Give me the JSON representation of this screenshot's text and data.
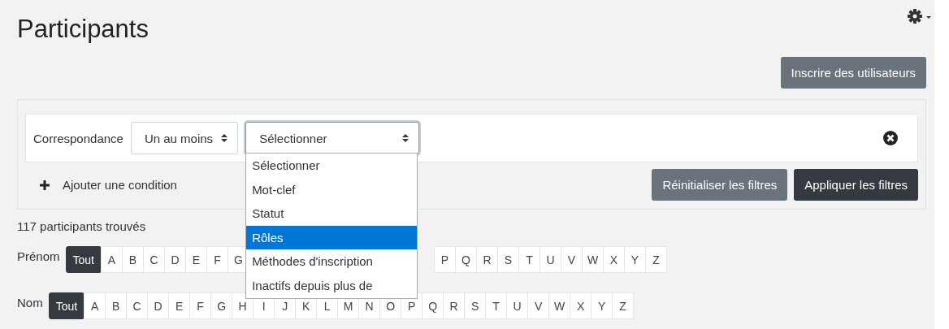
{
  "page": {
    "title": "Participants"
  },
  "enrol_button": "Inscrire des utilisateurs",
  "filter": {
    "match_label": "Correspondance",
    "match_value": "Un au moins",
    "type_value": "Sélectionner",
    "expanded": true,
    "options": [
      {
        "label": "Sélectionner",
        "selected": false
      },
      {
        "label": "Mot-clef",
        "selected": false
      },
      {
        "label": "Statut",
        "selected": false
      },
      {
        "label": "Rôles",
        "selected": true
      },
      {
        "label": "Méthodes d'inscription",
        "selected": false
      },
      {
        "label": "Inactifs depuis plus de",
        "selected": false
      }
    ],
    "add_condition": "Ajouter une condition",
    "reset_button": "Réinitialiser les filtres",
    "apply_button": "Appliquer les filtres"
  },
  "count": "117 participants trouvés",
  "initials_bars": [
    {
      "label": "Prénom",
      "letters": [
        {
          "label": "Tout",
          "selected": true
        },
        {
          "label": "A",
          "selected": false
        },
        {
          "label": "B",
          "selected": false
        },
        {
          "label": "C",
          "selected": false
        },
        {
          "label": "D",
          "selected": false
        },
        {
          "label": "E",
          "selected": false
        },
        {
          "label": "F",
          "selected": false
        },
        {
          "label": "G",
          "selected": false
        }
      ],
      "letters_after_menu": [
        {
          "label": "P",
          "selected": false
        },
        {
          "label": "Q",
          "selected": false
        },
        {
          "label": "R",
          "selected": false
        },
        {
          "label": "S",
          "selected": false
        },
        {
          "label": "T",
          "selected": false
        },
        {
          "label": "U",
          "selected": false
        },
        {
          "label": "V",
          "selected": false
        },
        {
          "label": "W",
          "selected": false
        },
        {
          "label": "X",
          "selected": false
        },
        {
          "label": "Y",
          "selected": false
        },
        {
          "label": "Z",
          "selected": false
        }
      ]
    },
    {
      "label": "Nom",
      "letters": [
        {
          "label": "Tout",
          "selected": true
        },
        {
          "label": "A",
          "selected": false
        },
        {
          "label": "B",
          "selected": false
        },
        {
          "label": "C",
          "selected": false
        },
        {
          "label": "D",
          "selected": false
        },
        {
          "label": "E",
          "selected": false
        },
        {
          "label": "F",
          "selected": false
        },
        {
          "label": "G",
          "selected": false
        },
        {
          "label": "H",
          "selected": false
        },
        {
          "label": "I",
          "selected": false
        },
        {
          "label": "J",
          "selected": false
        },
        {
          "label": "K",
          "selected": false
        },
        {
          "label": "L",
          "selected": false
        },
        {
          "label": "M",
          "selected": false
        },
        {
          "label": "N",
          "selected": false
        },
        {
          "label": "O",
          "selected": false
        },
        {
          "label": "P",
          "selected": false
        },
        {
          "label": "Q",
          "selected": false
        },
        {
          "label": "R",
          "selected": false
        },
        {
          "label": "S",
          "selected": false
        },
        {
          "label": "T",
          "selected": false
        },
        {
          "label": "U",
          "selected": false
        },
        {
          "label": "V",
          "selected": false
        },
        {
          "label": "W",
          "selected": false
        },
        {
          "label": "X",
          "selected": false
        },
        {
          "label": "Y",
          "selected": false
        },
        {
          "label": "Z",
          "selected": false
        }
      ]
    }
  ]
}
